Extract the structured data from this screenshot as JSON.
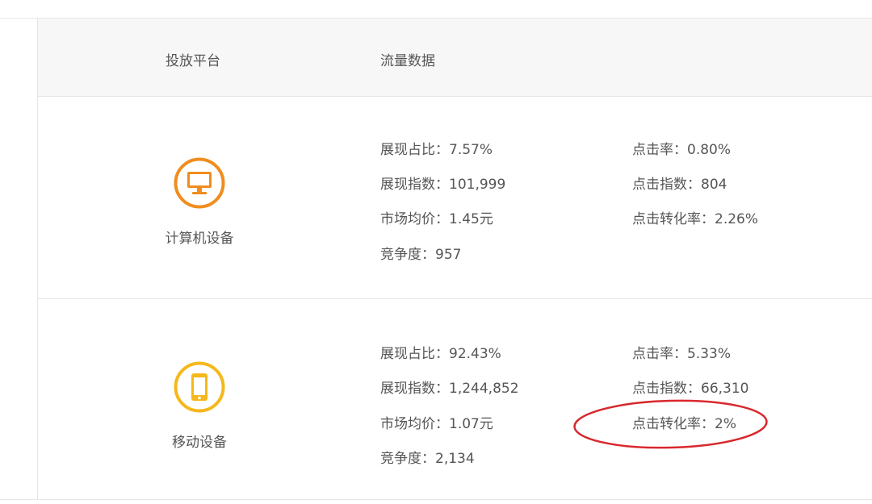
{
  "header": {
    "platform_label": "投放平台",
    "traffic_label": "流量数据"
  },
  "rows": [
    {
      "device": "计算机设备",
      "icon": "monitor-icon",
      "icon_color": "#F08D1E",
      "metrics_left": [
        "展现占比：7.57%",
        "展现指数：101,999",
        "市场均价：1.45元",
        "竞争度：957"
      ],
      "metrics_right": [
        "点击率：0.80%",
        "点击指数：804",
        "点击转化率：2.26%"
      ]
    },
    {
      "device": "移动设备",
      "icon": "mobile-phone-icon",
      "icon_color": "#F5B81C",
      "metrics_left": [
        "展现占比：92.43%",
        "展现指数：1,244,852",
        "市场均价：1.07元",
        "竞争度：2,134"
      ],
      "metrics_right": [
        "点击率：5.33%",
        "点击指数：66,310",
        "点击转化率：2%"
      ]
    }
  ],
  "annotation": {
    "color": "#D9272E",
    "target": "点击转化率：2%"
  }
}
